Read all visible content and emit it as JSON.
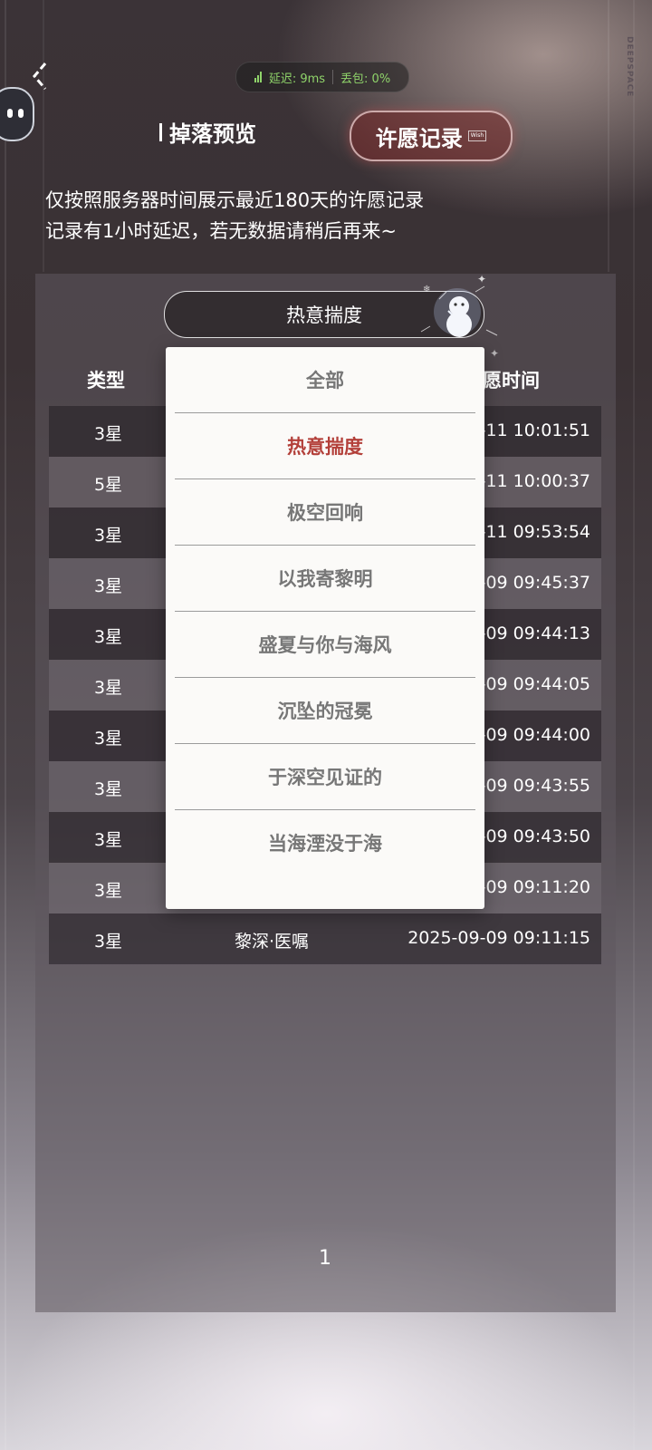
{
  "network": {
    "latency_label": "延迟: 9ms",
    "loss_label": "丢包: 0%",
    "color": "#8fd36a"
  },
  "brand_side": "DEEPSPACE",
  "tabs": {
    "drop_preview": "掉落预览",
    "wish_record": "许愿记录",
    "wish_record_mini": "Wish"
  },
  "notice": {
    "line1": "仅按照服务器时间展示最近180天的许愿记录",
    "line2": "记录有1小时延迟，若无数据请稍后再来~"
  },
  "filter": {
    "selected": "热意揣度"
  },
  "table": {
    "headers": {
      "type": "类型",
      "time": "愿时间"
    },
    "rows": [
      {
        "type": "3星",
        "name": "",
        "time": "-11 10:01:51"
      },
      {
        "type": "5星",
        "name": "",
        "time": "-11 10:00:37"
      },
      {
        "type": "3星",
        "name": "",
        "time": "-11 09:53:54"
      },
      {
        "type": "3星",
        "name": "",
        "time": "-09 09:45:37"
      },
      {
        "type": "3星",
        "name": "",
        "time": "-09 09:44:13"
      },
      {
        "type": "3星",
        "name": "",
        "time": "-09 09:44:05"
      },
      {
        "type": "3星",
        "name": "",
        "time": "-09 09:44:00"
      },
      {
        "type": "3星",
        "name": "",
        "time": "-09 09:43:55"
      },
      {
        "type": "3星",
        "name": "",
        "time": "-09 09:43:50"
      },
      {
        "type": "3星",
        "name": "",
        "time": "-09 09:11:20"
      },
      {
        "type": "3星",
        "name": "黎深·医嘱",
        "time": "2025-09-09 09:11:15"
      }
    ]
  },
  "dropdown": {
    "options": [
      "全部",
      "热意揣度",
      "极空回响",
      "以我寄黎明",
      "盛夏与你与海风",
      "沉坠的冠冕",
      "于深空见证的",
      "当海湮没于海"
    ],
    "selected_index": 1,
    "selected_color": "#b3403a"
  },
  "pagination": {
    "current": "1"
  }
}
